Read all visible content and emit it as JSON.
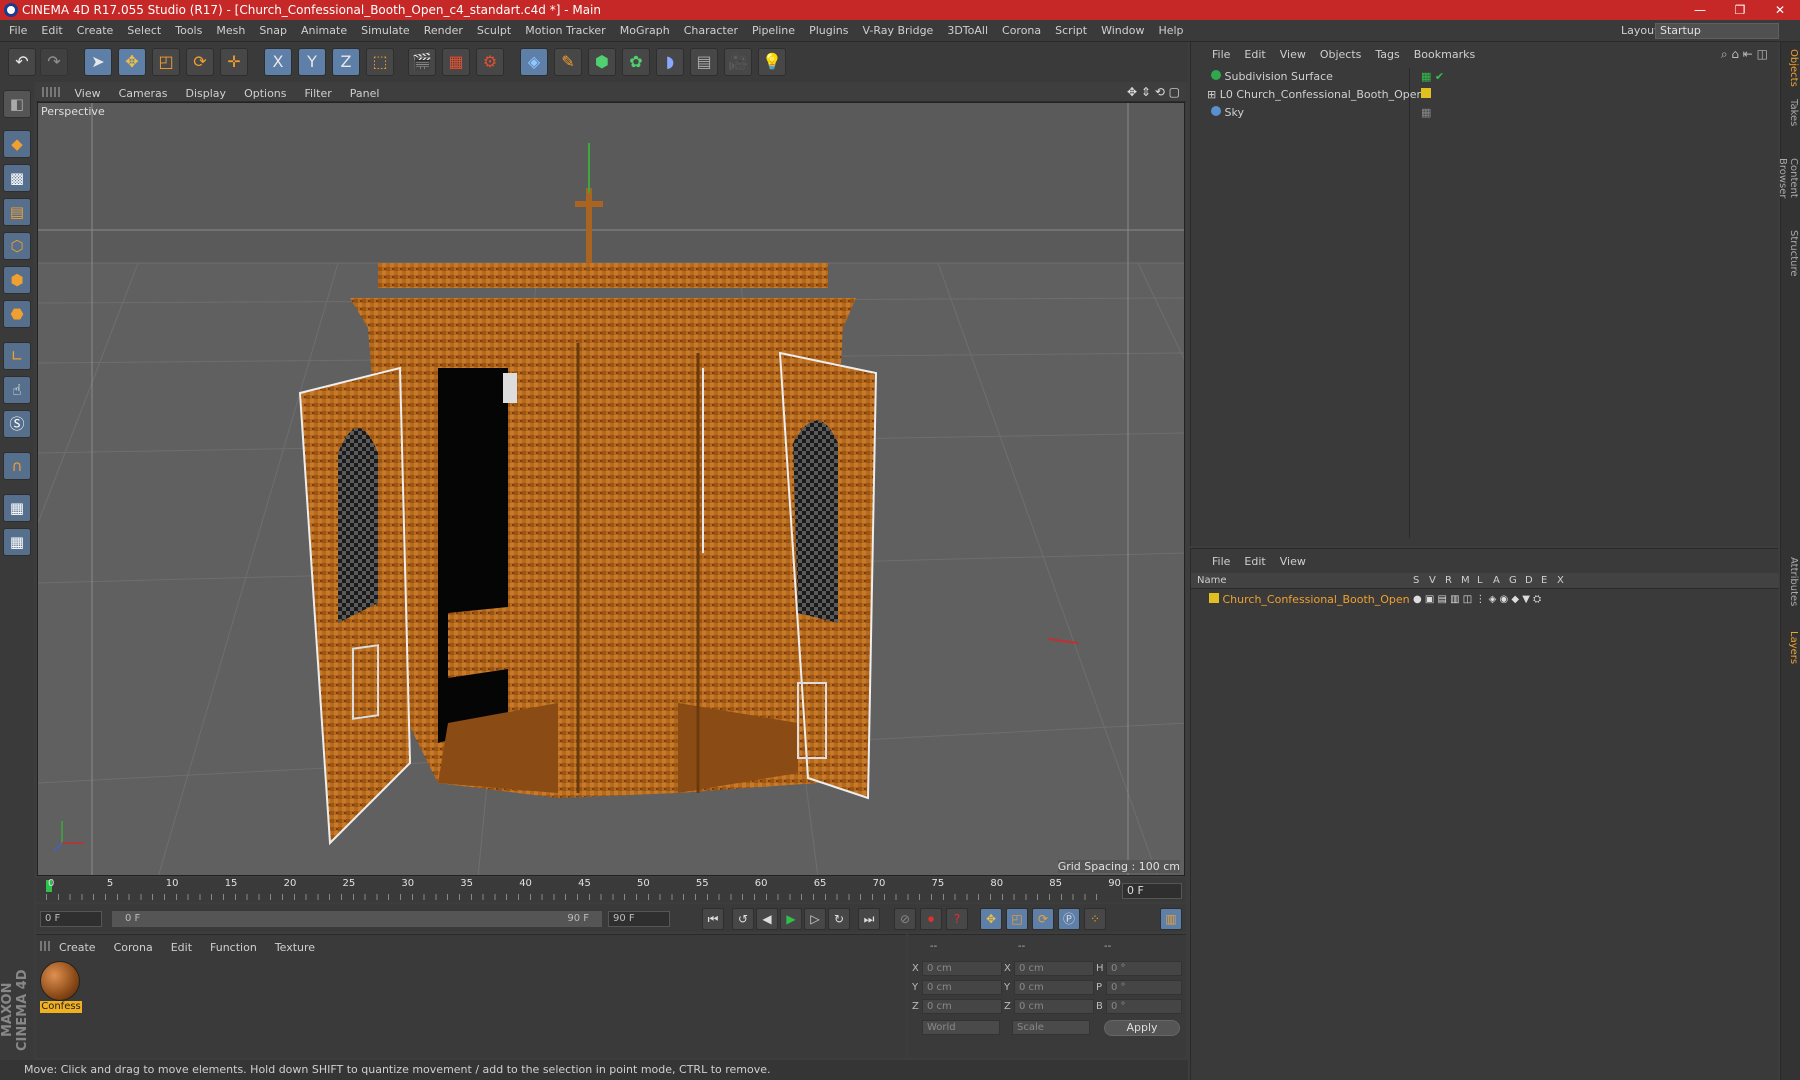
{
  "window": {
    "title": "CINEMA 4D R17.055 Studio (R17) - [Church_Confessional_Booth_Open_c4_standart.c4d *] - Main",
    "controls": {
      "minimize": "—",
      "restore": "❐",
      "close": "✕"
    }
  },
  "menubar": {
    "items": [
      "File",
      "Edit",
      "Create",
      "Select",
      "Tools",
      "Mesh",
      "Snap",
      "Animate",
      "Simulate",
      "Render",
      "Sculpt",
      "Motion Tracker",
      "MoGraph",
      "Character",
      "Pipeline",
      "Plugins",
      "V-Ray Bridge",
      "3DToAll",
      "Corona",
      "Script",
      "Window",
      "Help"
    ],
    "layout_label": "Layout:",
    "layout_value": "Startup"
  },
  "toolbar": {
    "icons": [
      "undo-icon",
      "redo-icon",
      "select-arrow-icon",
      "move-icon",
      "scale-icon",
      "rotate-icon",
      "move-plus-icon",
      "x-axis-icon",
      "y-axis-icon",
      "z-axis-icon",
      "world-coords-icon",
      "render-view-icon",
      "render-picture-viewer-icon",
      "render-settings-icon",
      "cube-icon",
      "pen-icon",
      "subdivision-icon",
      "cloner-icon",
      "deformer-icon",
      "floor-icon",
      "camera-icon",
      "light-icon"
    ],
    "axis_labels": [
      "X",
      "Y",
      "Z"
    ]
  },
  "viewport": {
    "menu": [
      "View",
      "Cameras",
      "Display",
      "Options",
      "Filter",
      "Panel"
    ],
    "label": "Perspective",
    "grid_spacing": "Grid Spacing : 100 cm"
  },
  "timeline": {
    "ticks": [
      "0",
      "5",
      "10",
      "15",
      "20",
      "25",
      "30",
      "35",
      "40",
      "45",
      "50",
      "55",
      "60",
      "65",
      "70",
      "75",
      "80",
      "85",
      "90"
    ],
    "current_frame": "0 F"
  },
  "playback": {
    "start_field": "0 F",
    "range_start": "0 F",
    "range_end": "90 F",
    "end_field": "90 F"
  },
  "material_manager": {
    "menu": [
      "Create",
      "Corona",
      "Edit",
      "Function",
      "Texture"
    ],
    "materials": [
      {
        "name": "Confess"
      }
    ]
  },
  "coordinates": {
    "headers": [
      "--",
      "--",
      "--"
    ],
    "rows": [
      {
        "label1": "X",
        "val1": "0 cm",
        "label2": "X",
        "val2": "0 cm",
        "label3": "H",
        "val3": "0 °"
      },
      {
        "label1": "Y",
        "val1": "0 cm",
        "label2": "Y",
        "val2": "0 cm",
        "label3": "P",
        "val3": "0 °"
      },
      {
        "label1": "Z",
        "val1": "0 cm",
        "label2": "Z",
        "val2": "0 cm",
        "label3": "B",
        "val3": "0 °"
      }
    ],
    "mode_world": "World",
    "mode_scale": "Scale",
    "apply": "Apply"
  },
  "status": {
    "text": "Move: Click and drag to move elements. Hold down SHIFT to quantize movement / add to the selection in point mode, CTRL to remove."
  },
  "object_manager": {
    "menu": [
      "File",
      "Edit",
      "View",
      "Objects",
      "Tags",
      "Bookmarks"
    ],
    "objects": [
      {
        "name": "Subdivision Surface",
        "color": "#2fa84f"
      },
      {
        "name": "Church_Confessional_Booth_Open",
        "color": "#e0c020"
      },
      {
        "name": "Sky",
        "color": "#5a8fd0"
      }
    ]
  },
  "layer_manager": {
    "menu": [
      "File",
      "Edit",
      "View"
    ],
    "columns": [
      "Name",
      "S",
      "V",
      "R",
      "M",
      "L",
      "A",
      "G",
      "D",
      "E",
      "X"
    ],
    "layers": [
      {
        "name": "Church_Confessional_Booth_Open",
        "color": "#e0c020"
      }
    ]
  },
  "right_tabs": [
    "Objects",
    "Takes",
    "Content Browser",
    "Structure",
    "Attributes",
    "Layers"
  ],
  "colors": {
    "titlebar": "#c62828",
    "accent": "#f0a030",
    "wood": "#b86a20"
  }
}
